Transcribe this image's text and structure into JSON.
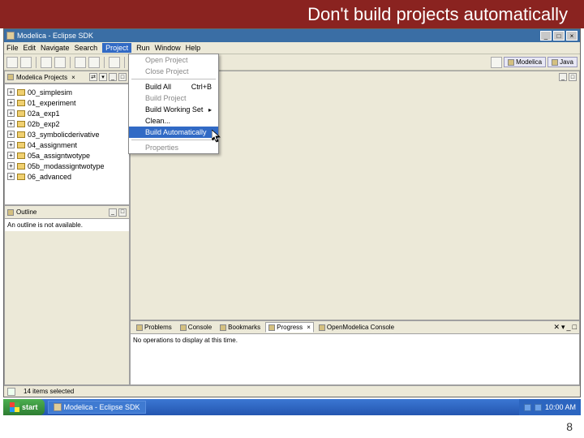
{
  "slide": {
    "title": "Don't build projects automatically",
    "page_number": "8"
  },
  "window": {
    "title": "Modelica - Eclipse SDK",
    "menus": [
      "File",
      "Edit",
      "Navigate",
      "Search",
      "Project",
      "Run",
      "Window",
      "Help"
    ],
    "active_menu": "Project",
    "perspective_buttons": [
      "Modelica",
      "Java"
    ]
  },
  "project_menu": {
    "items": [
      {
        "label": "Open Project",
        "enabled": false
      },
      {
        "label": "Close Project",
        "enabled": false
      },
      {
        "sep": true
      },
      {
        "label": "Build All",
        "shortcut": "Ctrl+B",
        "enabled": true
      },
      {
        "label": "Build Project",
        "enabled": false
      },
      {
        "label": "Build Working Set",
        "enabled": true,
        "submenu": true
      },
      {
        "label": "Clean...",
        "enabled": true
      },
      {
        "label": "Build Automatically",
        "enabled": true,
        "highlighted": true
      },
      {
        "sep": true
      },
      {
        "label": "Properties",
        "enabled": false
      }
    ]
  },
  "projects_view": {
    "title": "Modelica Projects",
    "items": [
      "00_simplesim",
      "01_experiment",
      "02a_exp1",
      "02b_exp2",
      "03_symbolicderivative",
      "04_assignment",
      "05a_assigntwotype",
      "05b_modassigntwotype",
      "06_advanced"
    ]
  },
  "outline": {
    "title": "Outline",
    "message": "An outline is not available."
  },
  "bottom_tabs": {
    "tabs": [
      "Problems",
      "Console",
      "Bookmarks",
      "Progress",
      "OpenModelica Console"
    ],
    "active": 3,
    "progress_message": "No operations to display at this time."
  },
  "statusbar": {
    "text": "14 items selected"
  },
  "taskbar": {
    "start": "start",
    "task": "Modelica - Eclipse SDK",
    "time": "10:00 AM"
  }
}
